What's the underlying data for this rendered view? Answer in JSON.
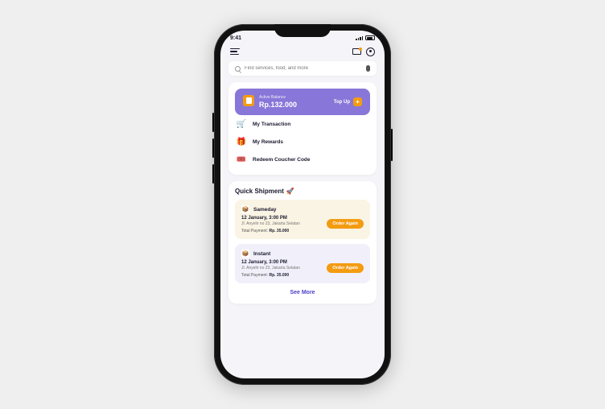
{
  "statusbar": {
    "time": "9:41"
  },
  "search": {
    "placeholder": "Find services, food, and more"
  },
  "balance": {
    "label": "Active Balance",
    "amount": "Rp.132.000",
    "topup_label": "Top Up"
  },
  "menu": {
    "transaction": "My Transaction",
    "rewards": "My Rewards",
    "redeem": "Redeem Coucher Code"
  },
  "quick": {
    "title": "Quick Shipment",
    "see_more": "See More",
    "items": [
      {
        "name": "Sameday",
        "date": "12 January, 3:00 PM",
        "address": "Jl. Anyelir no 23, Jakarta Selatan",
        "total_label": "Total Payment:",
        "total_value": "Rp. 35.000",
        "cta": "Order Again"
      },
      {
        "name": "Instant",
        "date": "12 January, 3:00 PM",
        "address": "Jl. Anyelir no 23, Jakarta Selatan",
        "total_label": "Total Payment:",
        "total_value": "Rp. 35.000",
        "cta": "Order Again"
      }
    ]
  }
}
